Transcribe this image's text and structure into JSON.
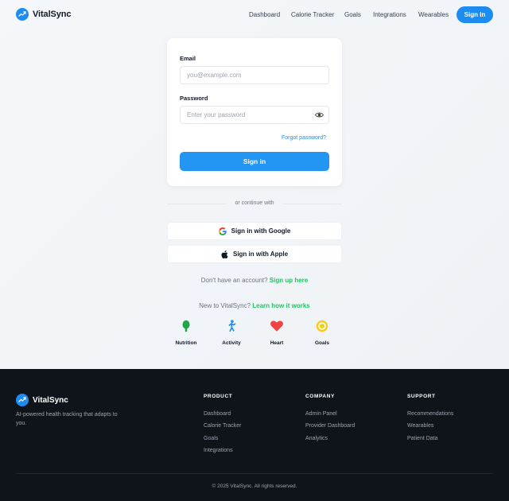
{
  "brand": {
    "name": "VitalSync",
    "accent": "#1d8cf0",
    "success": "#22c55e",
    "footer_bg": "#0f141b"
  },
  "nav": {
    "links": [
      "Dashboard",
      "Calorie Tracker",
      "Goals",
      "Integrations",
      "Wearables"
    ],
    "signin_label": "Sign In"
  },
  "form": {
    "email_label": "Email",
    "email_placeholder": "you@example.com",
    "password_label": "Password",
    "password_placeholder": "Enter your password",
    "forgot_label": "Forgot password?",
    "submit_label": "Sign in"
  },
  "divider_text": "or continue with",
  "social": {
    "google_label": "Sign in with Google",
    "apple_label": "Sign in with Apple"
  },
  "signup": {
    "prompt": "Don't have an account?",
    "link": "Sign up here"
  },
  "learn": {
    "prompt": "New to VitalSync?",
    "link": "Learn how it works"
  },
  "features": [
    {
      "label": "Nutrition",
      "icon": "nutrition-icon"
    },
    {
      "label": "Activity",
      "icon": "activity-icon"
    },
    {
      "label": "Heart",
      "icon": "heart-icon"
    },
    {
      "label": "Goals",
      "icon": "target-icon"
    }
  ],
  "footer": {
    "tagline": "AI-powered health tracking that adapts to you.",
    "columns": [
      {
        "title": "PRODUCT",
        "links": [
          "Dashboard",
          "Calorie Tracker",
          "Goals",
          "Integrations"
        ]
      },
      {
        "title": "COMPANY",
        "links": [
          "Admin Panel",
          "Provider Dashboard",
          "Analytics"
        ]
      },
      {
        "title": "SUPPORT",
        "links": [
          "Recommendations",
          "Wearables",
          "Patient Data"
        ]
      }
    ],
    "copyright": "© 2025 VitalSync. All rights reserved."
  }
}
